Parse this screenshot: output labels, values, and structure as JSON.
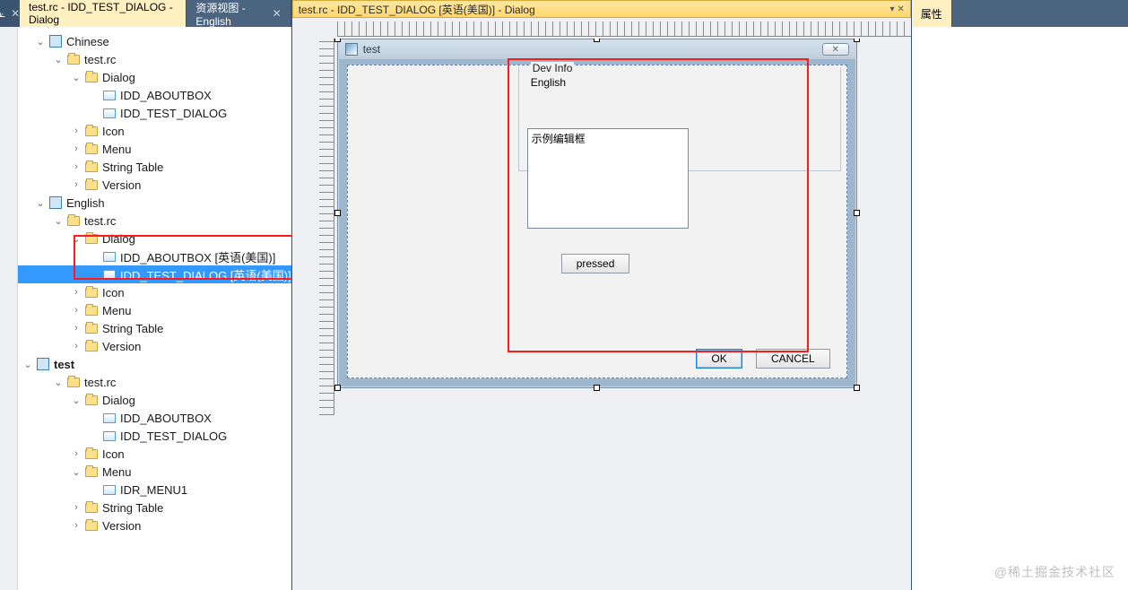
{
  "tabs": {
    "left_pin": "⟀",
    "doc_tab": "test.rc - IDD_TEST_DIALOG - Dialog",
    "resview_tab": "资源视图 - English"
  },
  "tree": {
    "chinese": "Chinese",
    "english": "English",
    "project": "test",
    "rc": "test.rc",
    "dialog": "Dialog",
    "icon": "Icon",
    "menu": "Menu",
    "stringtable": "String Table",
    "version": "Version",
    "idd_about": "IDD_ABOUTBOX",
    "idd_test": "IDD_TEST_DIALOG",
    "idd_about_en": "IDD_ABOUTBOX [英语(美国)]",
    "idd_test_en": "IDD_TEST_DIALOG [英语(美国)]",
    "idr_menu1": "IDR_MENU1"
  },
  "doc": {
    "header": "test.rc - IDD_TEST_DIALOG [英语(美国)] - Dialog"
  },
  "dialog": {
    "title": "test",
    "group_title": "Dev Info",
    "group_sub": "English",
    "edit_value": "示例编辑框",
    "btn_pressed": "pressed",
    "btn_ok": "OK",
    "btn_cancel": "CANCEL"
  },
  "right": {
    "tab": "属性"
  },
  "watermark": "@稀土掘金技术社区"
}
